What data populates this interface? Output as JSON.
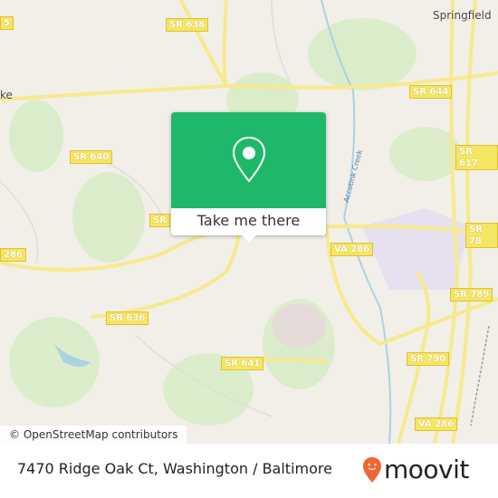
{
  "map": {
    "places": [
      "Springfield",
      "ke"
    ],
    "shields": [
      "5",
      "SR 638",
      "SR 644",
      "SR 640",
      "SR 617",
      "SR",
      "SR 78",
      "286",
      "VA 286",
      "SR 789",
      "SR 636",
      "SR 641",
      "SR 790",
      "VA 286"
    ],
    "creek": "Accotink Creek",
    "attribution": "© OpenStreetMap contributors"
  },
  "popup": {
    "icon": "map-pin-icon",
    "button_label": "Take me there",
    "color": "#1fb86a"
  },
  "footer": {
    "address": "7470 Ridge Oak Ct, Washington / Baltimore",
    "logo": "moovit",
    "logo_color": "#f26430"
  }
}
